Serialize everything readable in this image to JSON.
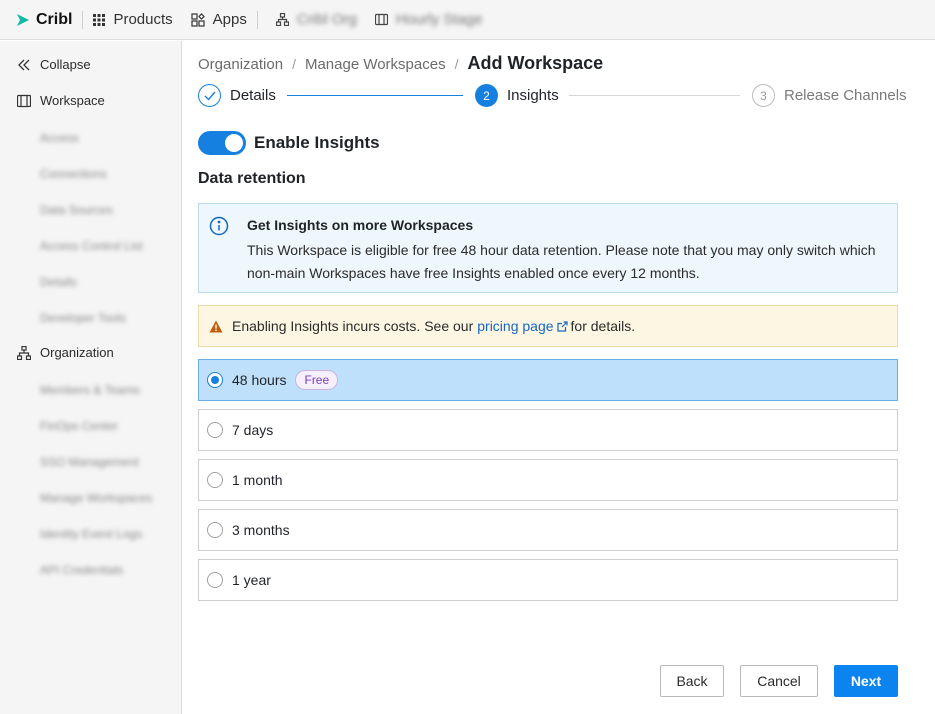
{
  "topbar": {
    "brand": "Cribl",
    "products": "Products",
    "apps": "Apps",
    "org": "Cribl Org",
    "workspace": "Hourly Stage"
  },
  "sidebar": {
    "collapse": "Collapse",
    "workspace": "Workspace",
    "workspace_items": [
      "Access",
      "Connections",
      "Data Sources",
      "Access Control List",
      "Details",
      "Developer Tools"
    ],
    "organization": "Organization",
    "organization_items": [
      "Members & Teams",
      "FinOps Center",
      "SSO Management",
      "Manage Workspaces",
      "Identity Event Logs",
      "API Credentials"
    ]
  },
  "breadcrumb": {
    "items": [
      "Organization",
      "Manage Workspaces"
    ],
    "separator": "/",
    "current": "Add Workspace"
  },
  "steps": [
    {
      "label": "Details",
      "status": "complete",
      "marker": "✓"
    },
    {
      "label": "Insights",
      "status": "active",
      "marker": "2"
    },
    {
      "label": "Release Channels",
      "status": "pending",
      "marker": "3"
    }
  ],
  "insights_toggle": {
    "label": "Enable Insights",
    "enabled": true
  },
  "section_title": "Data retention",
  "info": {
    "title": "Get Insights on more Workspaces",
    "body": "This Workspace is eligible for free 48 hour data retention. Please note that you may only switch which non-main Workspaces have free Insights enabled once every 12 months."
  },
  "warning": {
    "prefix": "Enabling Insights incurs costs. See our",
    "link": "pricing page",
    "suffix": "for details."
  },
  "retention_options": [
    {
      "label": "48 hours",
      "badge": "Free",
      "selected": true
    },
    {
      "label": "7 days",
      "selected": false
    },
    {
      "label": "1 month",
      "selected": false
    },
    {
      "label": "3 months",
      "selected": false
    },
    {
      "label": "1 year",
      "selected": false
    }
  ],
  "buttons": {
    "back": "Back",
    "cancel": "Cancel",
    "next": "Next"
  },
  "colors": {
    "accent": "#0b84ef",
    "selected_bg": "#bfe0fb",
    "info_bg": "#eef7fd",
    "warning_bg": "#fdf6e3",
    "badge": "#7a3db8"
  }
}
